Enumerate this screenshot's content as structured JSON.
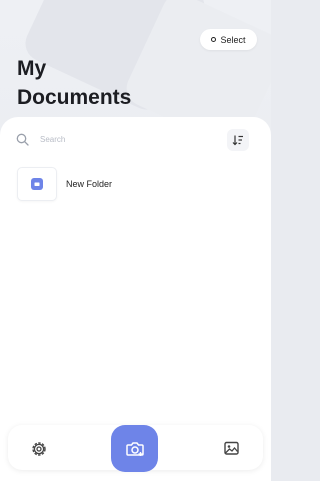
{
  "header": {
    "title_line1": "My",
    "title_line2": "Documents",
    "select_label": "Select"
  },
  "search": {
    "placeholder": "Search"
  },
  "folders": [
    {
      "name": "New Folder",
      "icon": "folder-icon"
    }
  ],
  "tabbar": {
    "items": [
      {
        "icon": "gear-icon"
      },
      {
        "icon": "camera-icon"
      },
      {
        "icon": "gallery-icon"
      }
    ]
  },
  "colors": {
    "accent": "#6e84e8",
    "background": "#eef0f4",
    "surface": "#ffffff",
    "text": "#1c1d22",
    "placeholder": "#b8bcc6"
  }
}
